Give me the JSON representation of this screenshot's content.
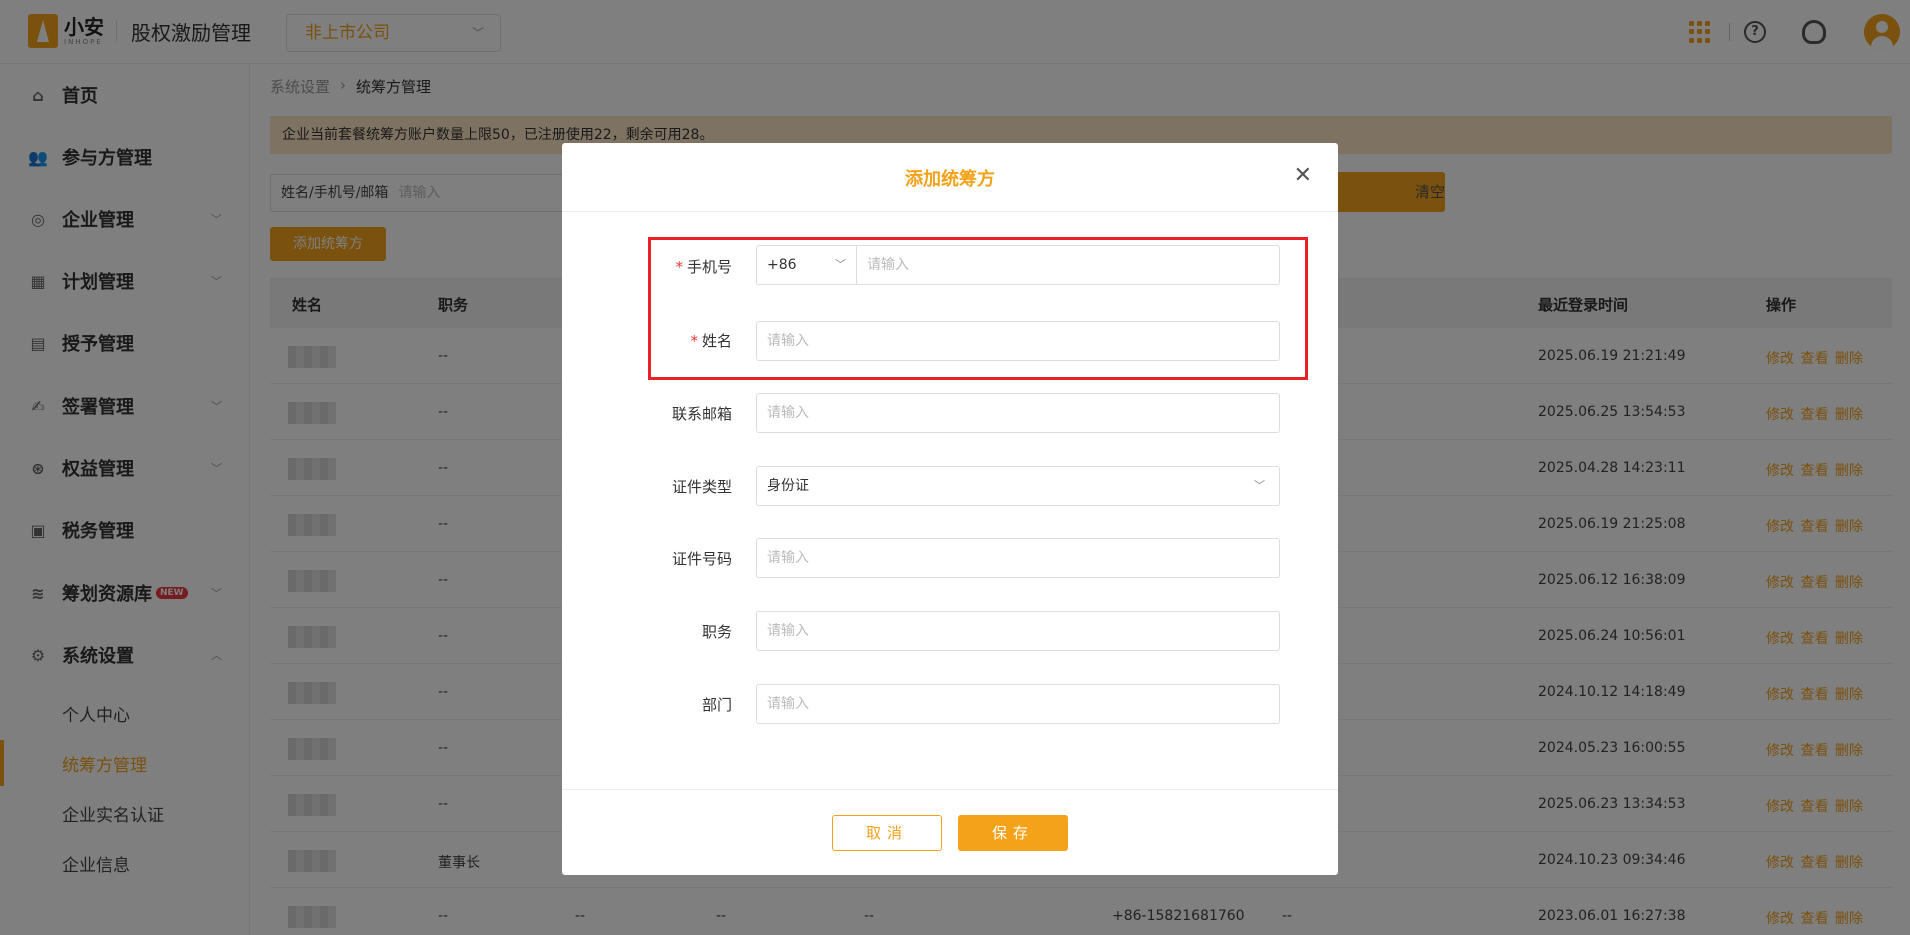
{
  "header": {
    "logo_cn": "小安",
    "logo_en": "INHOPE",
    "app_title": "股权激励管理",
    "company_select": "非上市公司"
  },
  "sidebar": {
    "items": [
      {
        "label": "首页",
        "icon": "home-icon"
      },
      {
        "label": "参与方管理",
        "icon": "users-icon"
      },
      {
        "label": "企业管理",
        "icon": "company-icon"
      },
      {
        "label": "计划管理",
        "icon": "plan-icon"
      },
      {
        "label": "授予管理",
        "icon": "grant-icon"
      },
      {
        "label": "签署管理",
        "icon": "sign-icon"
      },
      {
        "label": "权益管理",
        "icon": "equity-icon"
      },
      {
        "label": "税务管理",
        "icon": "tax-icon"
      },
      {
        "label": "筹划资源库",
        "icon": "resource-icon",
        "badge": "NEW"
      },
      {
        "label": "系统设置",
        "icon": "settings-icon"
      }
    ],
    "sub_items": [
      "个人中心",
      "统筹方管理",
      "企业实名认证",
      "企业信息"
    ]
  },
  "breadcrumb": [
    "系统设置",
    "统筹方管理"
  ],
  "notice": "企业当前套餐统筹方账户数量上限50，已注册使用22，剩余可用28。",
  "filter": {
    "label": "姓名/手机号/邮箱",
    "placeholder": "请输入",
    "clear": "清空"
  },
  "add_button": "添加统筹方",
  "table": {
    "headers": [
      "姓名",
      "职务",
      "最近登录时间",
      "操作"
    ],
    "ops": "修改 查看 删除",
    "rows": [
      {
        "position": "--",
        "time": "2025.06.19 21:21:49"
      },
      {
        "position": "--",
        "time": "2025.06.25 13:54:53"
      },
      {
        "position": "--",
        "time": "2025.04.28 14:23:11"
      },
      {
        "position": "--",
        "time": "2025.06.19 21:25:08"
      },
      {
        "position": "--",
        "time": "2025.06.12 16:38:09"
      },
      {
        "position": "--",
        "time": "2025.06.24 10:56:01"
      },
      {
        "position": "--",
        "time": "2024.10.12 14:18:49"
      },
      {
        "position": "--",
        "time": "2024.05.23 16:00:55"
      },
      {
        "position": "--",
        "time": "2025.06.23 13:34:53"
      },
      {
        "position": "董事长",
        "time": "2024.10.23 09:34:46"
      },
      {
        "position": "--",
        "time": "2023.06.01 16:27:38",
        "extra": [
          "--",
          "--",
          "--",
          "+86-15821681760",
          "--"
        ]
      }
    ]
  },
  "modal": {
    "title": "添加统筹方",
    "fields": {
      "phone": {
        "label": "手机号",
        "code": "+86",
        "placeholder": "请输入"
      },
      "name": {
        "label": "姓名",
        "placeholder": "请输入"
      },
      "email": {
        "label": "联系邮箱",
        "placeholder": "请输入"
      },
      "id_type": {
        "label": "证件类型",
        "value": "身份证"
      },
      "id_number": {
        "label": "证件号码",
        "placeholder": "请输入"
      },
      "position": {
        "label": "职务",
        "placeholder": "请输入"
      },
      "department": {
        "label": "部门",
        "placeholder": "请输入"
      }
    },
    "cancel": "取消",
    "save": "保存"
  },
  "colors": {
    "accent": "#f5a21b",
    "highlight": "#e8202a"
  }
}
